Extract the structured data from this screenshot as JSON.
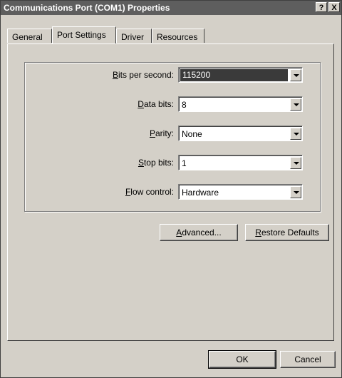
{
  "window": {
    "title": "Communications Port (COM1) Properties",
    "help_button": "?",
    "close_button": "X"
  },
  "tabs": [
    {
      "label": "General",
      "active": false
    },
    {
      "label": "Port Settings",
      "active": true
    },
    {
      "label": "Driver",
      "active": false
    },
    {
      "label": "Resources",
      "active": false
    }
  ],
  "settings": {
    "bits_per_second": {
      "label_pre": "",
      "label_mn": "B",
      "label_post": "its per second:",
      "value": "115200"
    },
    "data_bits": {
      "label_pre": "",
      "label_mn": "D",
      "label_post": "ata bits:",
      "value": "8"
    },
    "parity": {
      "label_pre": "",
      "label_mn": "P",
      "label_post": "arity:",
      "value": "None"
    },
    "stop_bits": {
      "label_pre": "",
      "label_mn": "S",
      "label_post": "top bits:",
      "value": "1"
    },
    "flow_control": {
      "label_pre": "",
      "label_mn": "F",
      "label_post": "low control:",
      "value": "Hardware"
    }
  },
  "buttons": {
    "advanced": {
      "mn": "A",
      "rest": "dvanced..."
    },
    "restore": {
      "mn": "R",
      "rest": "estore Defaults"
    },
    "ok": "OK",
    "cancel": "Cancel"
  }
}
